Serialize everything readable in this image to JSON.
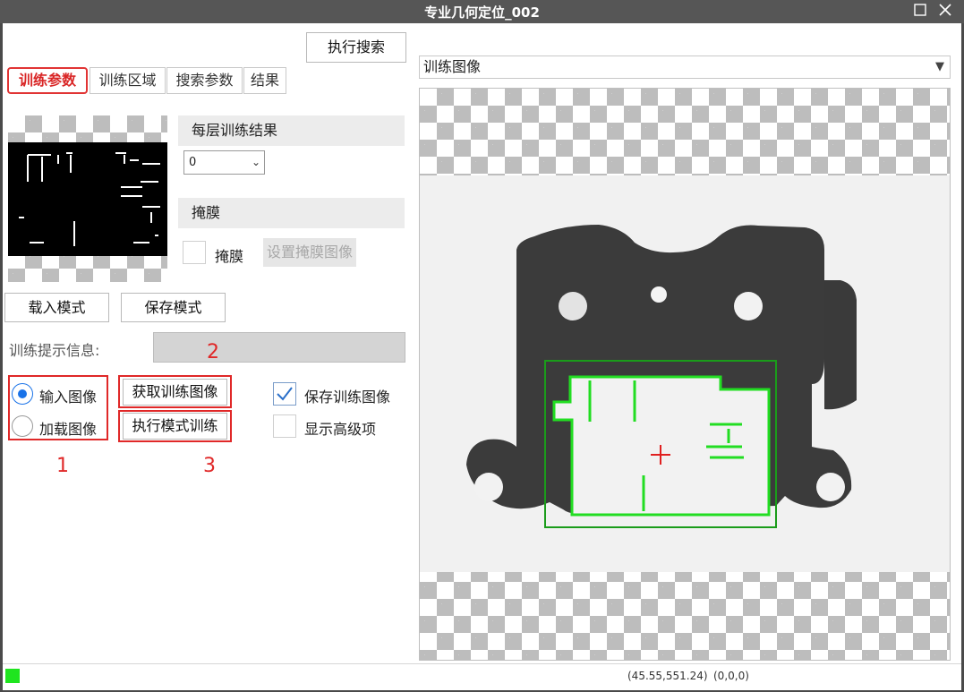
{
  "window": {
    "title": "专业几何定位_002",
    "maximize_icon": "maximize-icon",
    "close_icon": "close-icon"
  },
  "toolbar": {
    "search_label": "执行搜索"
  },
  "tabs": [
    {
      "label": "训练参数",
      "active": true
    },
    {
      "label": "训练区域",
      "active": false
    },
    {
      "label": "搜索参数",
      "active": false
    },
    {
      "label": "结果",
      "active": false
    }
  ],
  "train_result": {
    "header": "每层训练结果",
    "level_select": {
      "value": "0",
      "options": [
        "0"
      ]
    }
  },
  "mask": {
    "header": "掩膜",
    "checkbox_label": "掩膜",
    "checked": false,
    "set_button_label": "设置掩膜图像"
  },
  "model_buttons": {
    "load_label": "载入模式",
    "save_label": "保存模式"
  },
  "prompt": {
    "label": "训练提示信息:",
    "value": ""
  },
  "image_source": {
    "options": [
      {
        "label": "输入图像",
        "selected": true
      },
      {
        "label": "加载图像",
        "selected": false
      }
    ]
  },
  "train_actions": {
    "get_image_label": "获取训练图像",
    "train_label": "执行模式训练"
  },
  "options": {
    "save_train_image": {
      "label": "保存训练图像",
      "checked": true
    },
    "show_advanced": {
      "label": "显示高级项",
      "checked": false
    }
  },
  "annotations": {
    "n1": "1",
    "n2": "2",
    "n3": "3"
  },
  "viewer": {
    "image_select": {
      "value": "训练图像"
    },
    "roi_color": "#1a9c1a",
    "edge_color": "#22dd22",
    "center_color": "#e02020"
  },
  "status": {
    "indicator_color": "#1fe51f",
    "coordinates": "(45.55,551.24)",
    "pixel_value": "(0,0,0)"
  }
}
